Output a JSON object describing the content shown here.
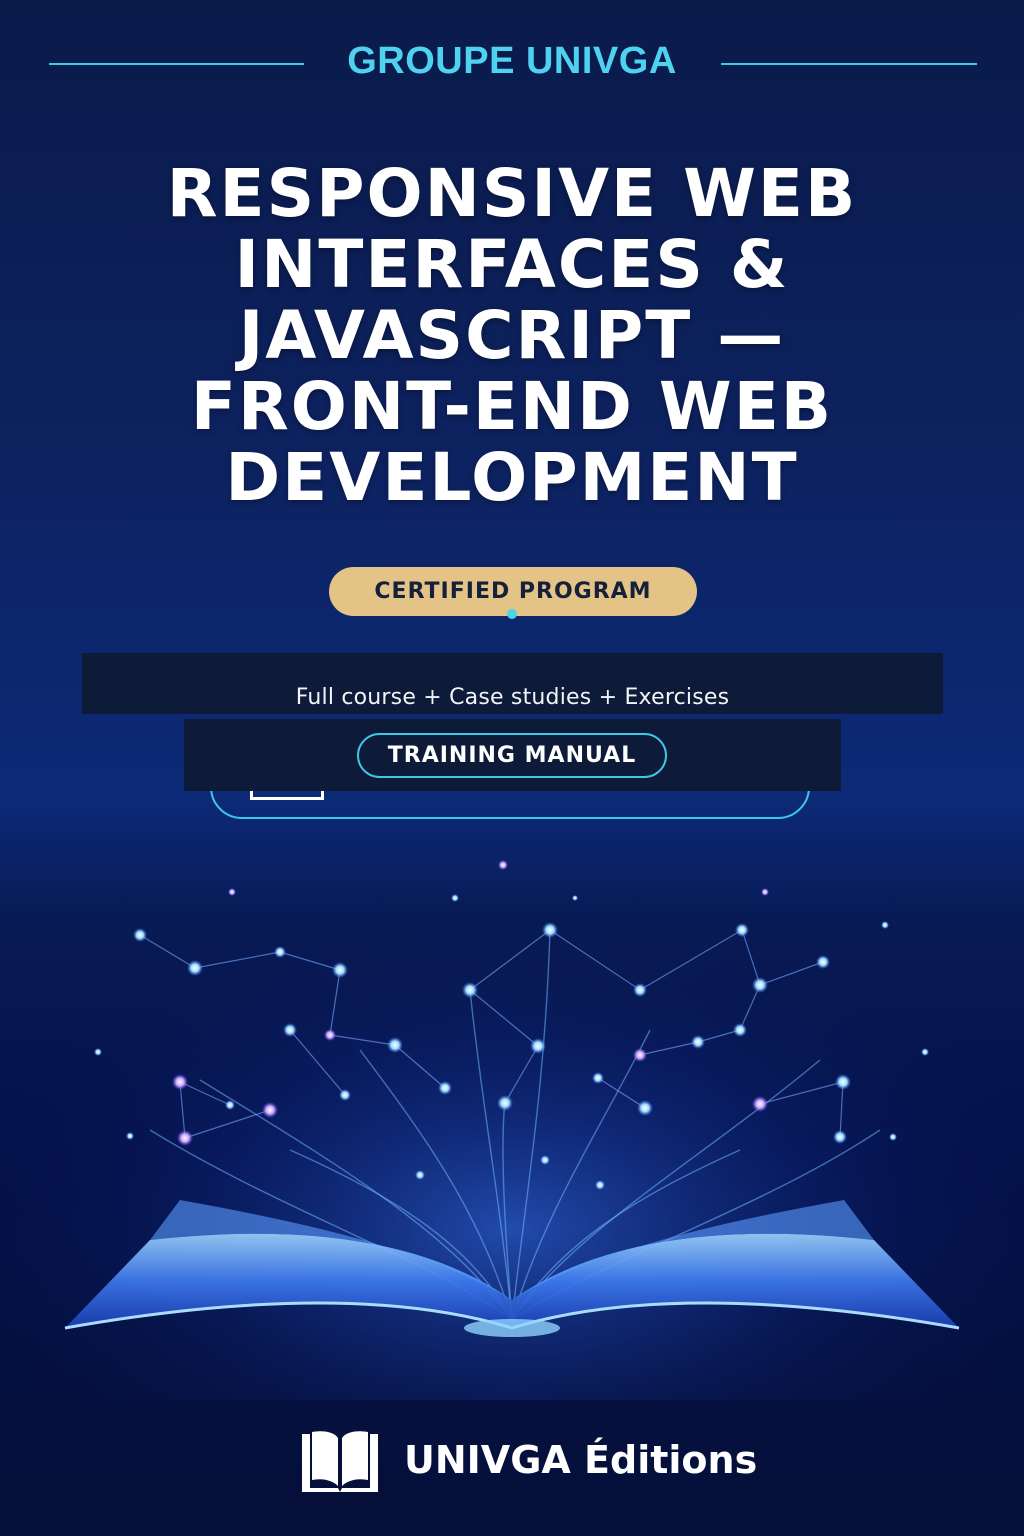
{
  "publisher_group": "GROUPE UNIVGA",
  "title": "RESPONSIVE WEB INTERFACES & JAVASCRIPT — FRONT-END WEB DEVELOPMENT",
  "badges": {
    "certified": "CERTIFIED PROGRAM",
    "manual": "TRAINING MANUAL"
  },
  "contents_line": "Full course + Case studies + Exercises",
  "footer": {
    "publisher": "UNIVGA Éditions"
  },
  "icons": [
    "open-book-icon"
  ],
  "colors": {
    "accent_cyan": "#4fd2f0",
    "gold_pill": "#e3c486",
    "background_navy": "#0c2a78"
  }
}
